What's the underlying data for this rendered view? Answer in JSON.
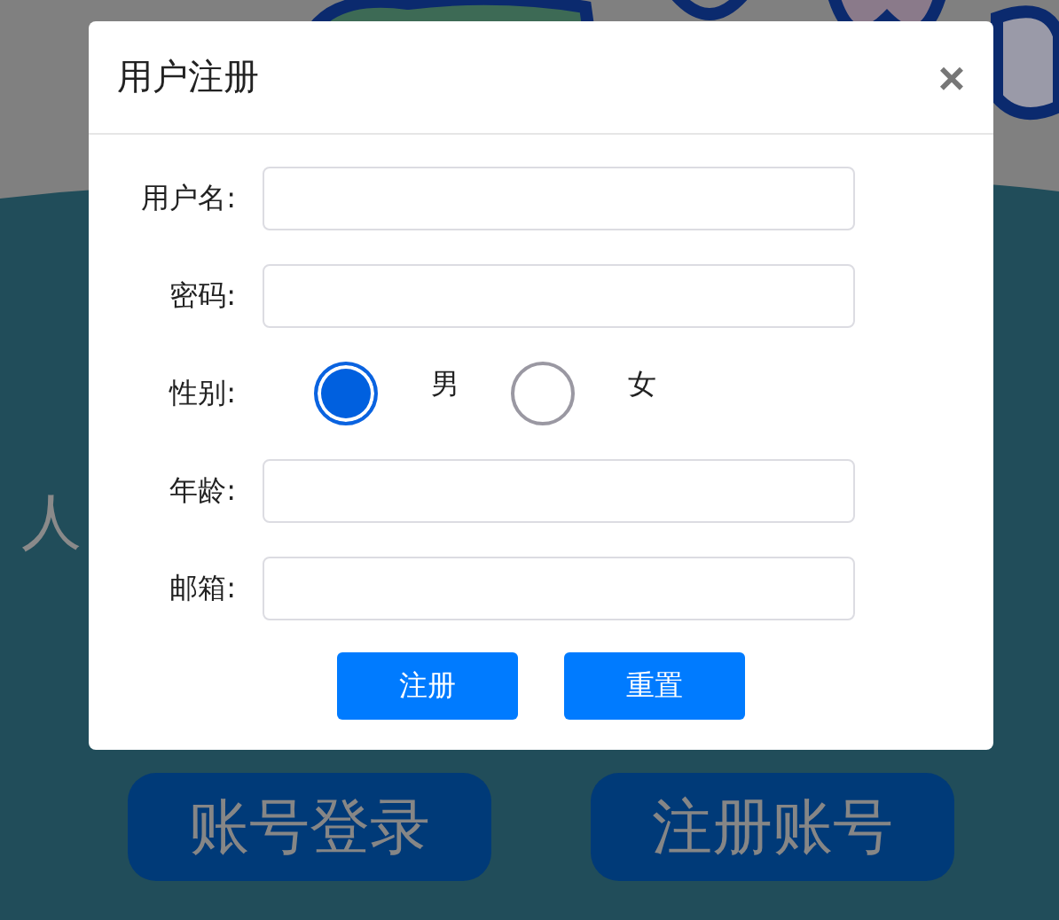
{
  "background": {
    "glyphs": [
      {
        "text": "人",
        "kind": "medium"
      }
    ],
    "buttons": [
      "账号登录",
      "注册账号"
    ]
  },
  "dialog": {
    "title": "用户注册",
    "close": "×",
    "fields": [
      {
        "kind": "text",
        "label": "用户名:"
      },
      {
        "kind": "text",
        "label": "密码:"
      },
      {
        "kind": "radio",
        "label": "性别:",
        "options": [
          {
            "label": "男",
            "selected": true
          },
          {
            "label": "女",
            "selected": false
          }
        ]
      },
      {
        "kind": "text",
        "label": "年龄:"
      },
      {
        "kind": "text",
        "label": "邮箱:"
      }
    ],
    "buttons": [
      "注册",
      "重置"
    ]
  }
}
